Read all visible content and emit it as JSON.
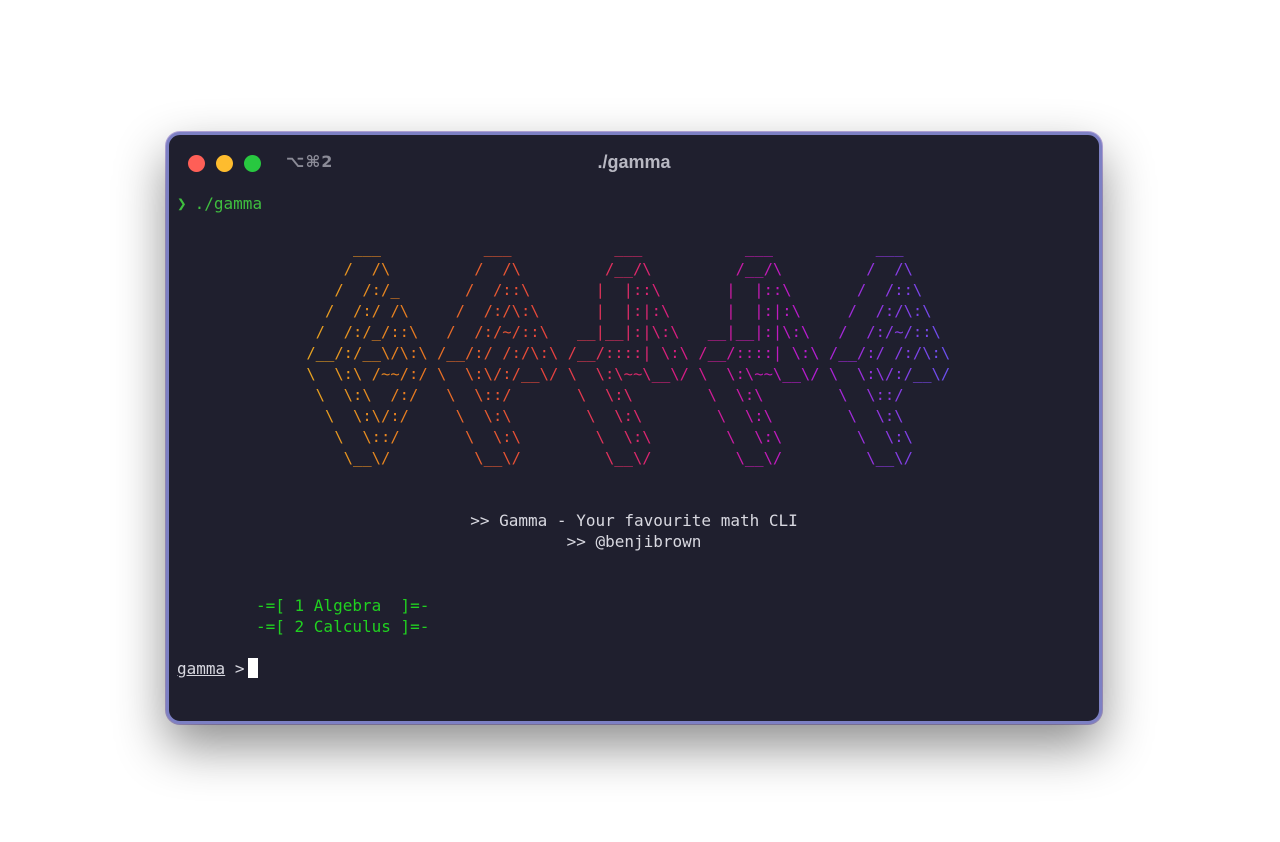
{
  "window": {
    "title": "./gamma",
    "shortcut": "⌥⌘2",
    "controls": {
      "close_color": "#fe5f57",
      "minimize_color": "#febc2e",
      "zoom_color": "#28c840"
    }
  },
  "terminal": {
    "prompt_symbol": "❯",
    "command": "./gamma",
    "ascii_art": "      ___           ___           ___           ___           ___     \n     /  /\\         /  /\\         /__/\\         /__/\\         /  /\\    \n    /  /:/_       /  /::\\       |  |::\\       |  |::\\       /  /::\\   \n   /  /:/ /\\     /  /:/\\:\\      |  |:|:\\      |  |:|:\\     /  /:/\\:\\  \n  /  /:/_/::\\   /  /:/~/::\\   __|__|:|\\:\\   __|__|:|\\:\\   /  /:/~/::\\ \n /__/:/__\\/\\:\\ /__/:/ /:/\\:\\ /__/::::| \\:\\ /__/::::| \\:\\ /__/:/ /:/\\:\\\n \\  \\:\\ /~~/:/ \\  \\:\\/:/__\\/ \\  \\:\\~~\\__\\/ \\  \\:\\~~\\__\\/ \\  \\:\\/:/__\\/\n  \\  \\:\\  /:/   \\  \\::/       \\  \\:\\        \\  \\:\\        \\  \\::/     \n   \\  \\:\\/:/     \\  \\:\\        \\  \\:\\        \\  \\:\\        \\  \\:\\     \n    \\  \\::/       \\  \\:\\        \\  \\:\\        \\  \\:\\        \\  \\:\\    \n     \\__\\/         \\__\\/         \\__\\/         \\__\\/         \\__\\/    ",
    "tagline": ">> Gamma - Your favourite math CLI",
    "author": ">> @benjibrown",
    "menu": [
      {
        "label": "-=[ 1 Algebra  ]=-"
      },
      {
        "label": "-=[ 2 Calculus ]=-"
      }
    ],
    "input_prompt_name": "gamma",
    "input_prompt_symbol": ">",
    "input_value": ""
  },
  "colors": {
    "background": "#1f1f2e",
    "prompt_green": "#3fbf3f",
    "menu_green": "#20d020",
    "text": "#d8d8e0"
  }
}
